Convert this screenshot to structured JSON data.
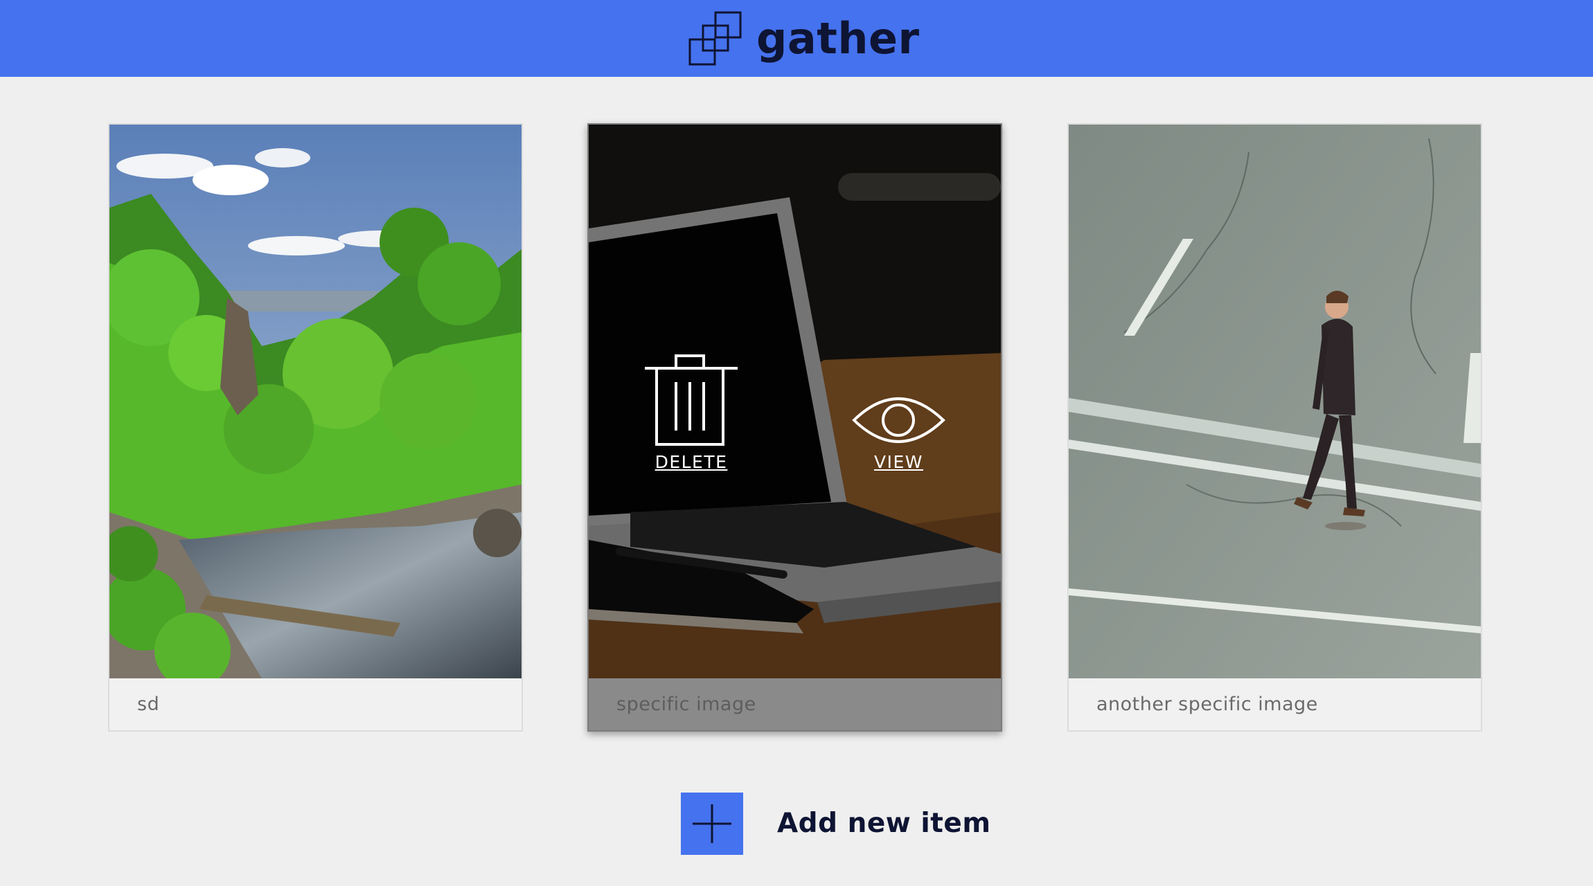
{
  "header": {
    "brand": "gather",
    "logo_icon": "stacked-squares-icon",
    "color": "#4572ee"
  },
  "gallery": {
    "items": [
      {
        "caption": "sd",
        "image": "forest-river-photo"
      },
      {
        "caption": "specific image",
        "image": "laptop-desk-photo",
        "actions": {
          "delete": "DELETE",
          "view": "VIEW"
        }
      },
      {
        "caption": "another specific image",
        "image": "man-walking-road-photo"
      }
    ]
  },
  "add_item": {
    "label": "Add new item",
    "icon": "plus-icon"
  }
}
